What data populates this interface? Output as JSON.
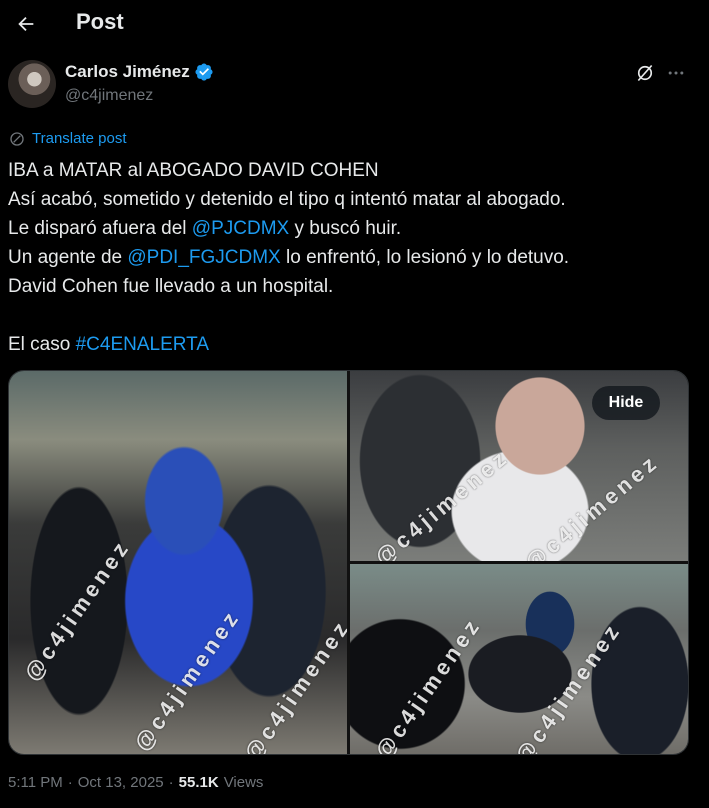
{
  "header": {
    "title": "Post",
    "back_icon": "arrow-left-icon"
  },
  "author": {
    "name": "Carlos Jiménez",
    "handle": "@c4jimenez",
    "verified": true,
    "verified_color": "#1d9bf0"
  },
  "translate_label": "Translate post",
  "post": {
    "line1": "IBA a MATAR al ABOGADO DAVID COHEN",
    "line2": "Así acabó, sometido y detenido el tipo q intentó matar al abogado.",
    "line3_pre": "Le disparó afuera del ",
    "line3_mention": "@PJCDMX",
    "line3_post": " y buscó huir.",
    "line4_pre": "Un agente de ",
    "line4_mention": "@PDI_FGJCDMX",
    "line4_post": " lo enfrentó, lo lesionó y lo detuvo.",
    "line5": "David Cohen fue llevado a un hospital.",
    "line6_pre": "El caso ",
    "line6_hashtag": "#C4ENALERTA"
  },
  "media": {
    "watermark": "@c4jimenez",
    "hide_label": "Hide",
    "image_count": 3
  },
  "meta": {
    "time": "5:11 PM",
    "separator": "·",
    "date": "Oct 13, 2025",
    "views_count": "55.1K",
    "views_label": "Views"
  },
  "colors": {
    "background": "#000000",
    "link": "#1d9bf0",
    "muted": "#71767b",
    "text": "#e7e9ea"
  }
}
